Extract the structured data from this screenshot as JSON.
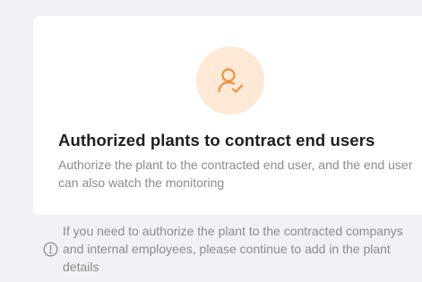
{
  "card": {
    "icon": "user-check-icon",
    "accent_color": "#f0913a",
    "icon_bg_color": "#fde9d6",
    "title": "Authorized plants to contract end users",
    "description": "Authorize the plant to the contracted end user, and the end user can also watch the monitoring"
  },
  "tip": {
    "icon": "info-circle-icon",
    "text": "If you need to authorize the plant to the contracted companys and internal employees, please continue to add in the plant details"
  }
}
